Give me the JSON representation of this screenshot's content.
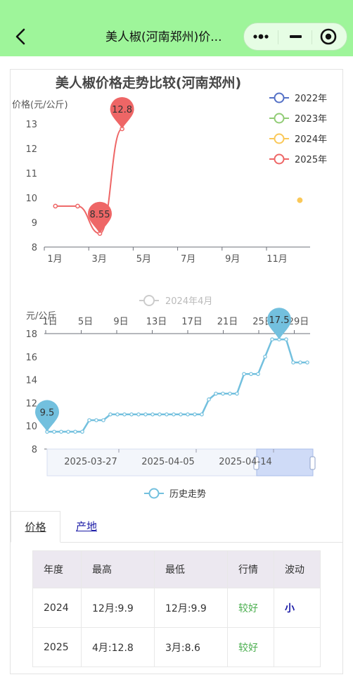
{
  "window": {
    "title": "美人椒(河南郑州)价...",
    "colors": {
      "topbar": "#9ef59a",
      "capsule": "#e6fde4"
    },
    "icons": [
      "back-arrow-icon",
      "more-dots-icon",
      "minimize-icon",
      "record-icon"
    ]
  },
  "chart_data": [
    {
      "type": "line",
      "title": "美人椒价格走势比较(河南郑州)",
      "ylabel": "价格(元/公斤)",
      "xlabel": "",
      "x_tick_labels": [
        "1月",
        "3月",
        "5月",
        "7月",
        "9月",
        "11月"
      ],
      "y_tick_labels": [
        "8",
        "9",
        "10",
        "11",
        "12",
        "13"
      ],
      "ylim": [
        8,
        13
      ],
      "x": [
        1,
        2,
        3,
        4,
        5,
        6,
        7,
        8,
        9,
        10,
        11,
        12
      ],
      "legend_position": "top-right",
      "grid": false,
      "series": [
        {
          "name": "2022年",
          "color": "#5470c6",
          "values": []
        },
        {
          "name": "2023年",
          "color": "#91cc75",
          "values": []
        },
        {
          "name": "2024年",
          "color": "#fac858",
          "values": [
            null,
            null,
            null,
            null,
            null,
            null,
            null,
            null,
            null,
            null,
            null,
            9.9
          ]
        },
        {
          "name": "2025年",
          "color": "#ee6666",
          "values": [
            9.66,
            9.66,
            8.55,
            12.8
          ]
        }
      ],
      "markers": [
        {
          "label": "12.8",
          "x": 4,
          "y": 12.8
        },
        {
          "label": "8.55",
          "x": 3,
          "y": 8.55
        }
      ]
    },
    {
      "type": "line",
      "title": "",
      "ylabel": "元/公斤",
      "xlabel": "",
      "legend_top": "2024年4月",
      "x_tick_labels": [
        "1日",
        "5日",
        "9日",
        "13日",
        "17日",
        "21日",
        "25日",
        "29日"
      ],
      "y_tick_labels": [
        "8",
        "10",
        "12",
        "14",
        "16",
        "18"
      ],
      "ylim": [
        8,
        18
      ],
      "grid": false,
      "series": [
        {
          "name": "历史走势",
          "color": "#73c0de",
          "values": [
            9.5,
            9.5,
            9.5,
            9.5,
            9.5,
            9.5,
            10.5,
            10.5,
            10.5,
            11,
            11,
            11,
            11,
            11,
            11,
            11,
            11,
            11,
            11,
            11,
            11,
            11,
            11,
            12.3,
            12.8,
            12.8,
            12.8,
            12.8,
            14.5,
            14.5,
            14.5,
            16,
            17.5,
            17.5,
            17.5,
            15.5,
            15.5,
            15.5
          ]
        }
      ],
      "markers": [
        {
          "label": "9.5",
          "index": 0,
          "y": 9.5
        },
        {
          "label": "17.5",
          "index": 33,
          "y": 17.5
        }
      ],
      "datazoom_labels": [
        "2025-03-27",
        "2025-04-05",
        "2025-04-14"
      ],
      "legend_bottom": "历史走势"
    }
  ],
  "tabs": [
    {
      "label": "价格",
      "active": true
    },
    {
      "label": "产地",
      "active": false
    }
  ],
  "table": {
    "headers": [
      "年度",
      "最高",
      "最低",
      "行情",
      "波动"
    ],
    "rows": [
      [
        "2024",
        "12月:9.9",
        "12月:9.9",
        "较好",
        "小"
      ],
      [
        "2025",
        "4月:12.8",
        "3月:8.6",
        "较好",
        ""
      ]
    ]
  }
}
